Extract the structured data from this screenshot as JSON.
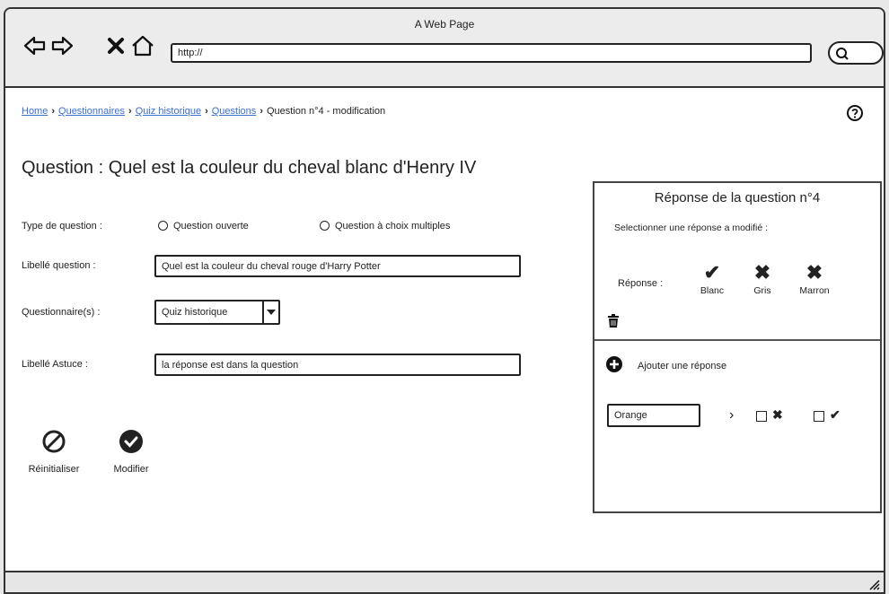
{
  "window": {
    "title": "A Web Page"
  },
  "browser": {
    "url": "http://"
  },
  "breadcrumb": {
    "items": [
      "Home",
      "Questionnaires",
      "Quiz historique",
      "Questions"
    ],
    "current": "Question n°4 - modification"
  },
  "question": {
    "title": "Question : Quel est la couleur du cheval blanc d'Henry IV"
  },
  "form": {
    "type_label": "Type de question :",
    "type_options": [
      "Question ouverte",
      "Question à choix multiples"
    ],
    "libelle_label": "Libellé question :",
    "libelle_value": "Quel est la couleur du cheval rouge d'Harry Potter",
    "questionnaire_label": "Questionnaire(s) :",
    "questionnaire_value": "Quiz historique",
    "astuce_label": "Libellé Astuce :",
    "astuce_value": "la réponse est dans la question"
  },
  "actions": {
    "reset_label": "Réinitialiser",
    "modify_label": "Modifier"
  },
  "panel": {
    "title": "Réponse de la question n°4",
    "subtitle": "Selectionner une réponse a modifié :",
    "reponse_label": "Réponse :",
    "reponses": [
      {
        "name": "Blanc",
        "mark": "✔"
      },
      {
        "name": "Gris",
        "mark": "✖"
      },
      {
        "name": "Marron",
        "mark": "✖"
      }
    ],
    "add_label": "Ajouter une réponse",
    "new_answer_value": "Orange",
    "chevron": "›",
    "false_mark": "✖",
    "true_mark": "✔"
  }
}
